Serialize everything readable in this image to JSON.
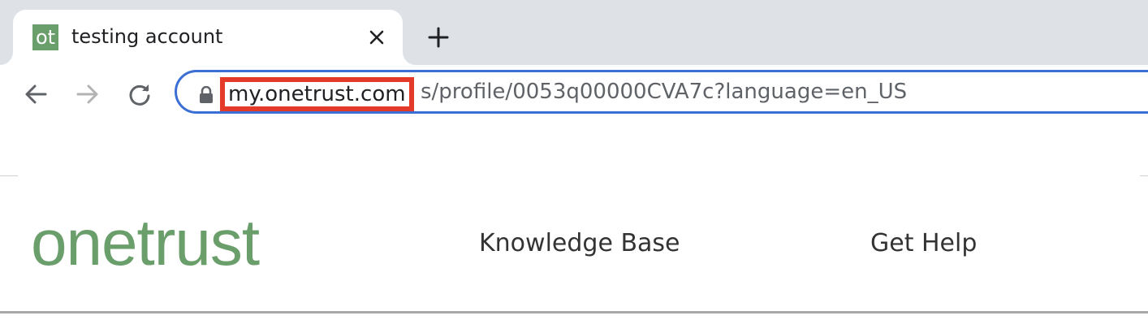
{
  "browser": {
    "tab": {
      "favicon_text": "ot",
      "title": "testing account"
    },
    "address_bar": {
      "host": "my.onetrust.com",
      "path": "s/profile/0053q00000CVA7c?language=en_US"
    }
  },
  "page": {
    "logo_text": "onetrust",
    "nav": [
      "Knowledge Base",
      "Get Help"
    ]
  },
  "colors": {
    "brand": "#6a9e6a",
    "highlight": "#e43a2a",
    "focus_ring": "#3b6fd4"
  }
}
